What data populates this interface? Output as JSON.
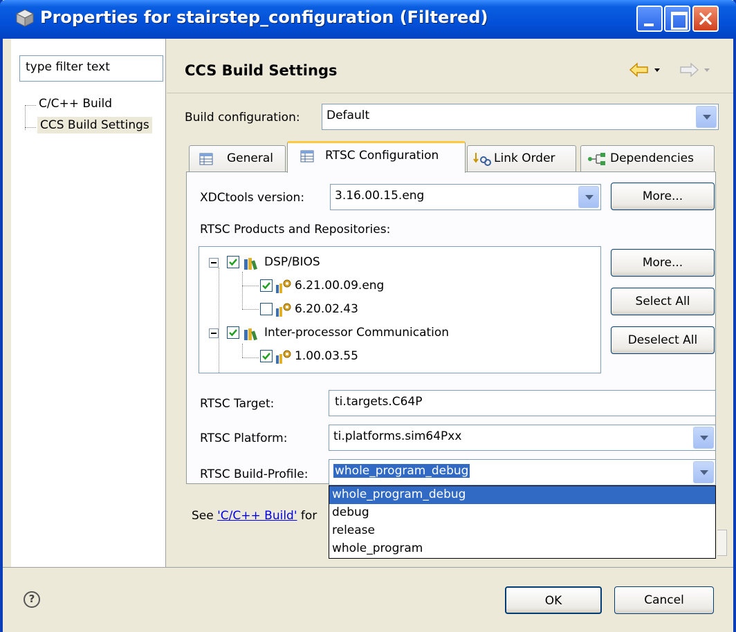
{
  "window": {
    "title": "Properties for stairstep_configuration (Filtered)"
  },
  "left_pane": {
    "filter_placeholder": "type filter text",
    "tree": [
      {
        "label": "C/C++ Build"
      },
      {
        "label": "CCS Build Settings",
        "selected": true
      }
    ]
  },
  "page": {
    "title": "CCS Build Settings",
    "build_config_label": "Build configuration:",
    "build_config_value": "Default"
  },
  "tabs": [
    {
      "label": "General",
      "icon": "table-icon"
    },
    {
      "label": "RTSC Configuration",
      "icon": "table-icon",
      "active": true
    },
    {
      "label": "Link Order",
      "icon": "link-order-icon"
    },
    {
      "label": "Dependencies",
      "icon": "dependencies-icon"
    }
  ],
  "rtsc": {
    "xdc_label": "XDCtools version:",
    "xdc_value": "3.16.00.15.eng",
    "more_label": "More...",
    "products_label": "RTSC Products and Repositories:",
    "products": [
      {
        "label": "DSP/BIOS",
        "checked": true,
        "level": 0
      },
      {
        "label": "6.21.00.09.eng",
        "checked": true,
        "level": 1
      },
      {
        "label": "6.20.02.43",
        "checked": false,
        "level": 1
      },
      {
        "label": "Inter-processor Communication",
        "checked": true,
        "level": 0
      },
      {
        "label": "1.00.03.55",
        "checked": true,
        "level": 1
      }
    ],
    "products_more_label": "More...",
    "select_all_label": "Select All",
    "deselect_all_label": "Deselect All",
    "target_label": "RTSC Target:",
    "target_value": "ti.targets.C64P",
    "platform_label": "RTSC Platform:",
    "platform_value": "ti.platforms.sim64Pxx",
    "profile_label": "RTSC Build-Profile:",
    "profile_value": "whole_program_debug",
    "profile_options": [
      "whole_program_debug",
      "debug",
      "release",
      "whole_program"
    ]
  },
  "footer_note": {
    "prefix": "See ",
    "link": "'C/C++ Build'",
    "suffix": " for"
  },
  "buttons": {
    "ok": "OK",
    "cancel": "Cancel",
    "help_glyph": "?"
  },
  "colors": {
    "title_bar": "#0350d8",
    "selection": "#316ac5",
    "tab_highlight": "#ffc83c"
  }
}
